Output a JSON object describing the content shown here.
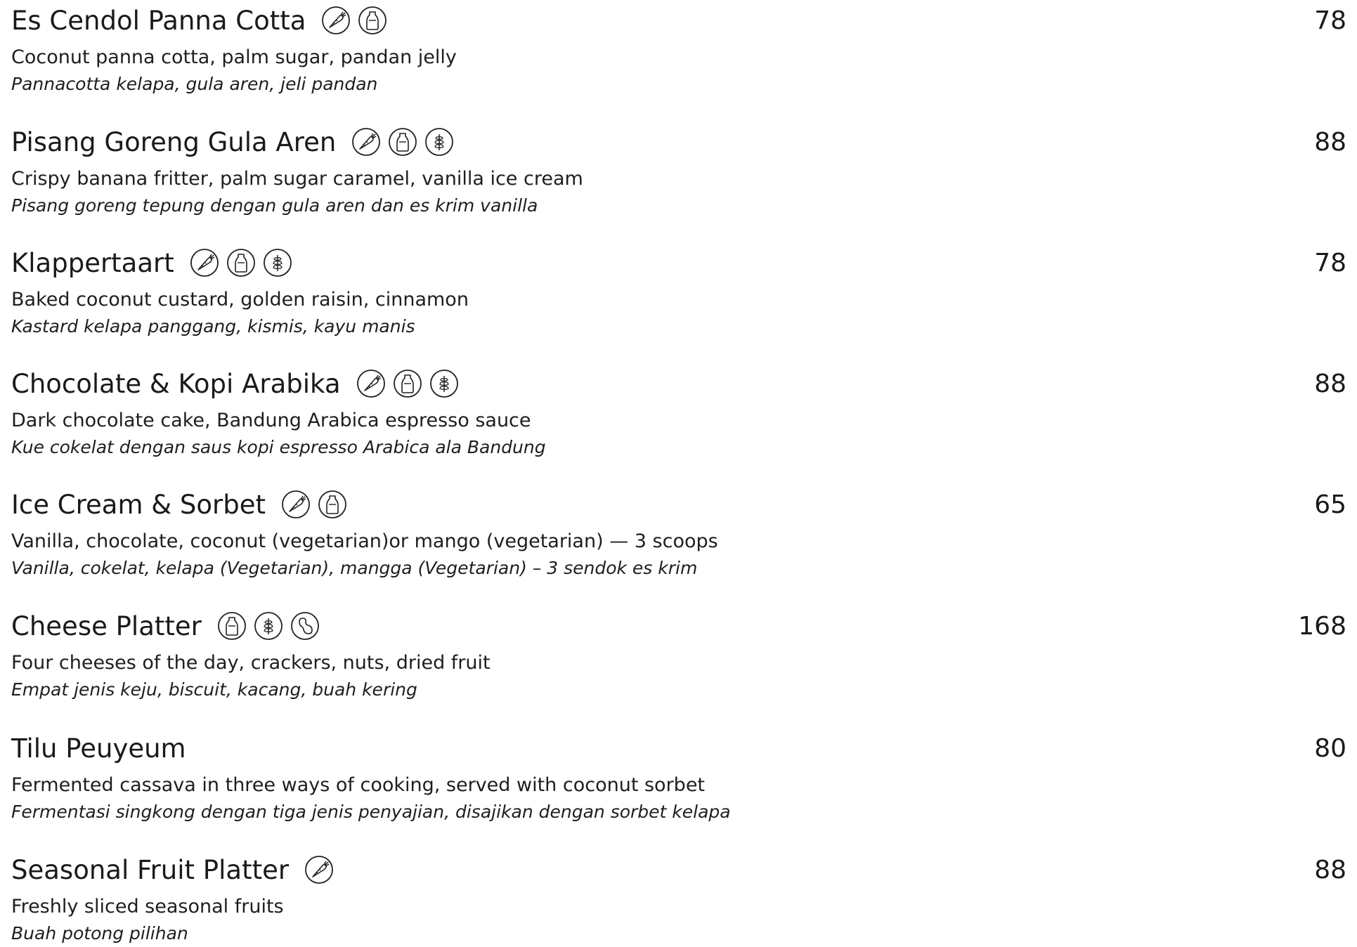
{
  "items": [
    {
      "name": "Es Cendol Panna Cotta",
      "price": "78",
      "description": "Coconut panna cotta, palm sugar, pandan jelly",
      "translation": "Pannacotta kelapa, gula aren, jeli pandan",
      "icons": [
        "vegetable-icon",
        "milk-bottle-icon"
      ]
    },
    {
      "name": "Pisang Goreng Gula Aren",
      "price": "88",
      "description": "Crispy banana fritter, palm sugar caramel, vanilla ice cream",
      "translation": "Pisang goreng tepung dengan gula aren dan es krim vanilla",
      "icons": [
        "vegetable-icon",
        "milk-bottle-icon",
        "wheat-icon"
      ]
    },
    {
      "name": "Klappertaart",
      "price": "78",
      "description": "Baked coconut custard, golden raisin, cinnamon",
      "translation": "Kastard kelapa panggang, kismis, kayu manis",
      "icons": [
        "vegetable-icon",
        "milk-bottle-icon",
        "wheat-icon"
      ]
    },
    {
      "name": "Chocolate & Kopi Arabika",
      "price": "88",
      "description": "Dark chocolate cake, Bandung Arabica espresso sauce",
      "translation": "Kue cokelat dengan saus kopi espresso Arabica ala Bandung",
      "icons": [
        "vegetable-icon",
        "milk-bottle-icon",
        "wheat-icon"
      ]
    },
    {
      "name": "Ice Cream & Sorbet",
      "price": "65",
      "description": "Vanilla, chocolate, coconut (vegetarian)or mango (vegetarian) — 3 scoops",
      "translation": "Vanilla, cokelat, kelapa (Vegetarian), mangga (Vegetarian) – 3 sendok es krim",
      "icons": [
        "vegetable-icon",
        "milk-bottle-icon"
      ]
    },
    {
      "name": "Cheese Platter",
      "price": "168",
      "description": "Four cheeses of the day, crackers, nuts, dried fruit",
      "translation": "Empat jenis keju, biscuit, kacang, buah kering",
      "icons": [
        "milk-bottle-icon",
        "wheat-icon",
        "peanut-icon"
      ]
    },
    {
      "name": "Tilu Peuyeum",
      "price": "80",
      "description": "Fermented cassava in three ways of cooking, served with coconut sorbet",
      "translation": "Fermentasi singkong dengan tiga jenis penyajian, disajikan dengan sorbet kelapa",
      "icons": []
    },
    {
      "name": "Seasonal Fruit Platter",
      "price": "88",
      "description": "Freshly sliced seasonal fruits",
      "translation": "Buah potong pilihan",
      "icons": [
        "vegetable-icon"
      ]
    }
  ]
}
